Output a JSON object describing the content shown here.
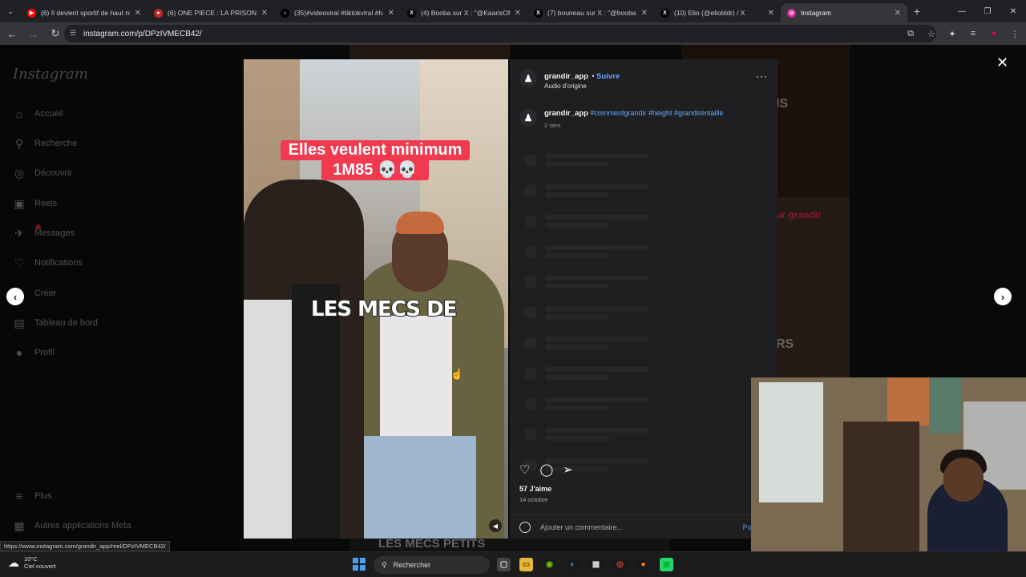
{
  "browser": {
    "tabs": [
      {
        "title": "(6) Il devient sportif de haut ni",
        "favicon_color": "#ff0000",
        "favicon": "▶"
      },
      {
        "title": "(6) ONE PIECE : LA PRISON D'E",
        "favicon_color": "#c1272d",
        "favicon": "●"
      },
      {
        "title": "(35)#videoviral #tiktokviral #ha",
        "favicon_color": "#000000",
        "favicon": "♪"
      },
      {
        "title": "(4) Booba sur X : \"@KaarisOffic",
        "favicon_color": "#000000",
        "favicon": "X"
      },
      {
        "title": "(7) bouneau sur X : \"@booba M",
        "favicon_color": "#000000",
        "favicon": "X"
      },
      {
        "title": "(10) Elio (@eliobldr) / X",
        "favicon_color": "#000000",
        "favicon": "X"
      },
      {
        "title": "Instagram",
        "favicon_color": "#d6249f",
        "favicon": "◎",
        "active": true
      }
    ],
    "url": "instagram.com/p/DPzIVMECB42/",
    "status_url": "https://www.instagram.com/grandir_app/reel/DPzIVMECB42/"
  },
  "instagram": {
    "logo": "Instagram",
    "nav": [
      {
        "label": "Accueil",
        "icon": "home-icon",
        "glyph": "⌂"
      },
      {
        "label": "Recherche",
        "icon": "search-icon",
        "glyph": "⚲"
      },
      {
        "label": "Découvrir",
        "icon": "compass-icon",
        "glyph": "◎"
      },
      {
        "label": "Reels",
        "icon": "reels-icon",
        "glyph": "▣"
      },
      {
        "label": "Messages",
        "icon": "messages-icon",
        "glyph": "✈"
      },
      {
        "label": "Notifications",
        "icon": "heart-icon",
        "glyph": "♡"
      },
      {
        "label": "Créer",
        "icon": "create-icon",
        "glyph": "⊕"
      },
      {
        "label": "Tableau de bord",
        "icon": "dashboard-icon",
        "glyph": "▤"
      },
      {
        "label": "Profil",
        "icon": "profile-icon",
        "glyph": "●"
      }
    ],
    "more": "Plus",
    "meta_apps": "Autres applications Meta"
  },
  "post": {
    "username": "grandir_app",
    "follow": "Suivre",
    "audio": "Audio d'origine",
    "caption_user": "grandir_app",
    "caption_tags": "#commentgrandir #height #grandirentaille",
    "caption_time": "2 sem",
    "likes": "57 J'aime",
    "date": "14 octobre",
    "comment_placeholder": "Ajouter un commentaire...",
    "publish": "Pu",
    "video_caption_line1": "Elles veulent minimum",
    "video_caption_line2": "1M85 💀💀",
    "video_overlay_text": "LES MECS DE"
  },
  "background_posts": {
    "text_a": "IS",
    "text_b": "ur grandir",
    "text_c": "RS",
    "text_d": "LES MECS PETITS"
  },
  "taskbar": {
    "temperature": "10°C",
    "weather": "Ciel couvert",
    "search": "Rechercher"
  }
}
